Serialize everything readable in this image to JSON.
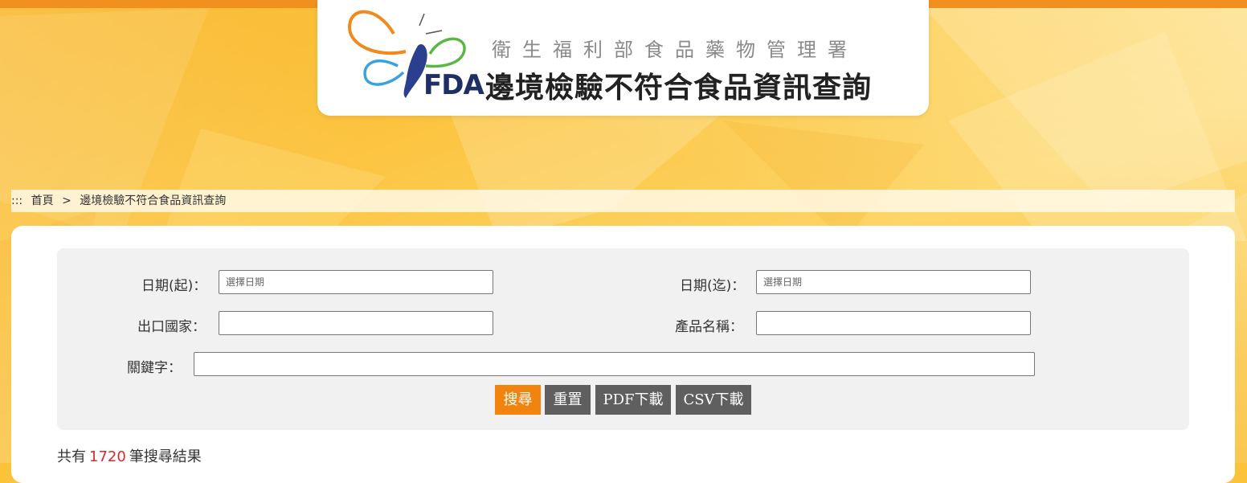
{
  "header": {
    "org_name": "衛生福利部食品藥物管理署",
    "fda_text": "FDA",
    "site_title": "邊境檢驗不符合食品資訊查詢"
  },
  "breadcrumb": {
    "accesskey": ":::",
    "home": "首頁",
    "separator": ">",
    "current": "邊境檢驗不符合食品資訊查詢"
  },
  "search_form": {
    "date_from": {
      "label": "日期(起)：",
      "value": "",
      "placeholder": "選擇日期"
    },
    "date_to": {
      "label": "日期(迄)：",
      "value": "",
      "placeholder": "選擇日期"
    },
    "export_country": {
      "label": "出口國家：",
      "value": ""
    },
    "product_name": {
      "label": "產品名稱：",
      "value": ""
    },
    "keyword": {
      "label": "關鍵字：",
      "value": ""
    },
    "buttons": {
      "search": "搜尋",
      "reset": "重置",
      "pdf_download": "PDF下載",
      "csv_download": "CSV下載"
    }
  },
  "results": {
    "prefix": "共有",
    "count": "1720",
    "suffix": "筆搜尋結果"
  },
  "colors": {
    "top_bar": "#f18f1f",
    "search_button": "#f0840e",
    "secondary_button": "#5f5f5f",
    "result_count": "#d62b2b",
    "logo_blue": "#2b3f8f",
    "logo_orange": "#f18a1c",
    "logo_green": "#5bb646",
    "logo_cyan": "#3aa3dc"
  },
  "icons": [
    "fda-butterfly-logo"
  ]
}
